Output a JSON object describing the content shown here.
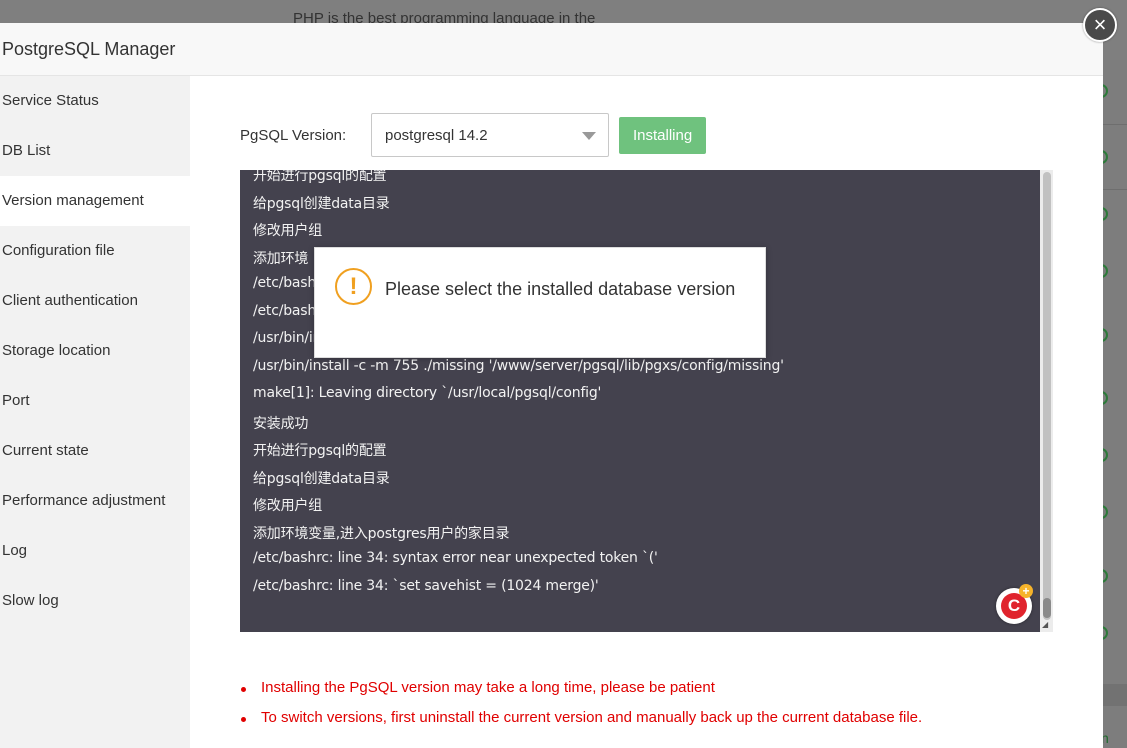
{
  "background": {
    "snippet": "PHP is the best programming language in the",
    "corner_letter": "n"
  },
  "modal": {
    "title": "PostgreSQL Manager",
    "close_icon": "×"
  },
  "sidebar": {
    "items": [
      {
        "label": "Service Status"
      },
      {
        "label": "DB List"
      },
      {
        "label": "Version management"
      },
      {
        "label": "Configuration file"
      },
      {
        "label": "Client authentication"
      },
      {
        "label": "Storage location"
      },
      {
        "label": "Port"
      },
      {
        "label": "Current state"
      },
      {
        "label": "Performance adjustment"
      },
      {
        "label": "Log"
      },
      {
        "label": "Slow log"
      }
    ],
    "active_index": 2
  },
  "version": {
    "label": "PgSQL Version:",
    "selected": "postgresql 14.2",
    "install_button": "Installing"
  },
  "console": {
    "lines": [
      "开始进行pgsql的配置",
      "给pgsql创建data目录",
      "修改用户组",
      "添加环境",
      "/etc/bash",
      "/etc/bash",
      "/usr/bin/in                                                                                                   sh'",
      "/usr/bin/install -c -m 755 ./missing '/www/server/pgsql/lib/pgxs/config/missing'",
      "make[1]: Leaving directory `/usr/local/pgsql/config'",
      "安装成功",
      "开始进行pgsql的配置",
      "给pgsql创建data目录",
      "修改用户组",
      "添加环境变量,进入postgres用户的家目录",
      "/etc/bashrc: line 34: syntax error near unexpected token `('",
      "/etc/bashrc: line 34: `set savehist = (1024 merge)'"
    ],
    "float_button_glyph": "C",
    "float_button_badge": "+"
  },
  "notes": [
    "Installing the PgSQL version may take a long time, please be patient",
    "To switch versions, first uninstall the current version and manually back up the current database file."
  ],
  "alert": {
    "icon": "!",
    "message": "Please select the installed database version"
  },
  "colors": {
    "accent_green": "#6fc27e",
    "console_bg": "#44424e",
    "warning": "#e00000",
    "alert_icon": "#f0a020"
  }
}
